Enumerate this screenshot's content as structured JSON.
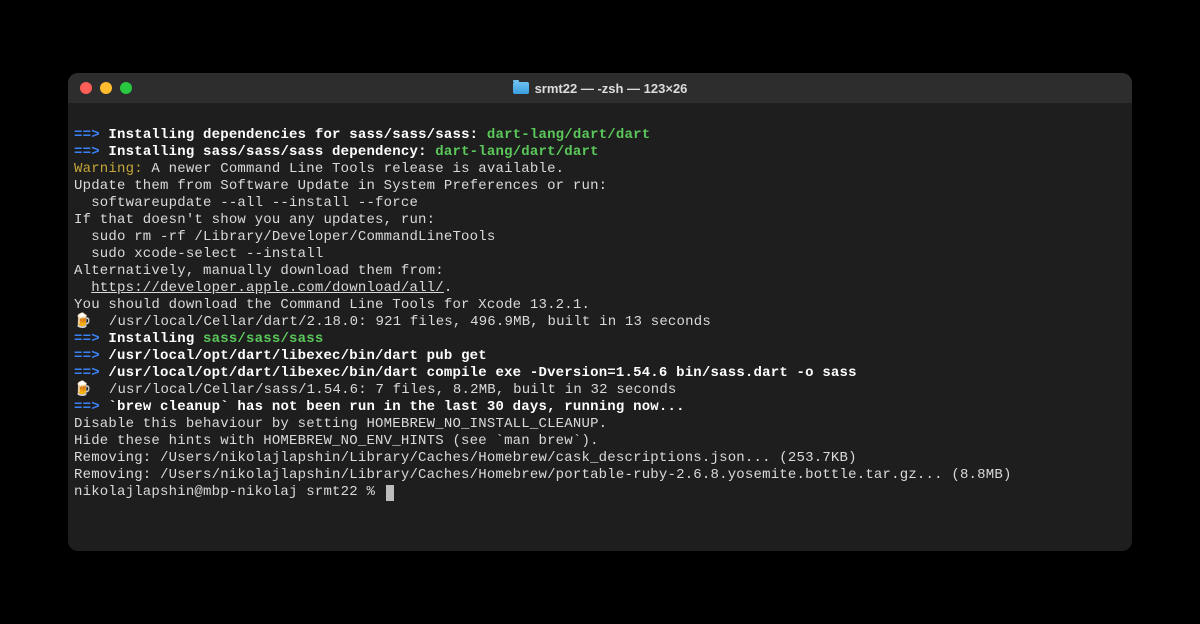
{
  "title": "srmt22 — -zsh — 123×26",
  "lines": {
    "l1_arrow": "==>",
    "l1_text": " Installing dependencies for sass/sass/sass: ",
    "l1_pkg": "dart-lang/dart/dart",
    "l2_arrow": "==>",
    "l2_text": " Installing sass/sass/sass dependency: ",
    "l2_pkg": "dart-lang/dart/dart",
    "l3_warn": "Warning:",
    "l3_text": " A newer Command Line Tools release is available.",
    "l4": "Update them from Software Update in System Preferences or run:",
    "l5": "  softwareupdate --all --install --force",
    "l6": "",
    "l7": "If that doesn't show you any updates, run:",
    "l8": "  sudo rm -rf /Library/Developer/CommandLineTools",
    "l9": "  sudo xcode-select --install",
    "l10": "",
    "l11": "Alternatively, manually download them from:",
    "l12_indent": "  ",
    "l12_link": "https://developer.apple.com/download/all/",
    "l12_dot": ".",
    "l13": "You should download the Command Line Tools for Xcode 13.2.1.",
    "l14": "",
    "l15_beer": "🍺",
    "l15_text": "  /usr/local/Cellar/dart/2.18.0: 921 files, 496.9MB, built in 13 seconds",
    "l16_arrow": "==>",
    "l16_text": " Installing ",
    "l16_pkg": "sass/sass/sass",
    "l17_arrow": "==>",
    "l17_text": " /usr/local/opt/dart/libexec/bin/dart pub get",
    "l18_arrow": "==>",
    "l18_text": " /usr/local/opt/dart/libexec/bin/dart compile exe -Dversion=1.54.6 bin/sass.dart -o sass",
    "l19_beer": "🍺",
    "l19_text": "  /usr/local/Cellar/sass/1.54.6: 7 files, 8.2MB, built in 32 seconds",
    "l20_arrow": "==>",
    "l20_text": " `brew cleanup` has not been run in the last 30 days, running now...",
    "l21": "Disable this behaviour by setting HOMEBREW_NO_INSTALL_CLEANUP.",
    "l22": "Hide these hints with HOMEBREW_NO_ENV_HINTS (see `man brew`).",
    "l23": "Removing: /Users/nikolajlapshin/Library/Caches/Homebrew/cask_descriptions.json... (253.7KB)",
    "l24": "Removing: /Users/nikolajlapshin/Library/Caches/Homebrew/portable-ruby-2.6.8.yosemite.bottle.tar.gz... (8.8MB)",
    "prompt": "nikolajlapshin@mbp-nikolaj srmt22 % "
  }
}
